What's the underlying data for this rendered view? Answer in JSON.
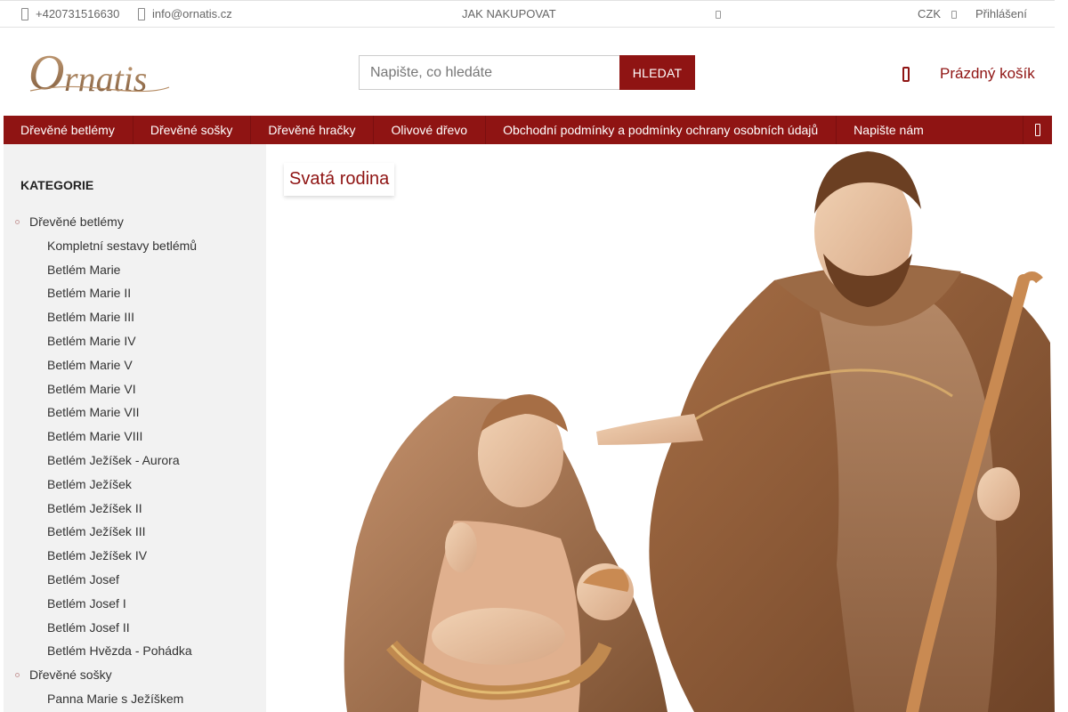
{
  "topbar": {
    "phone": "+420731516630",
    "email": "info@ornatis.cz",
    "how_to_buy": "JAK NAKUPOVAT",
    "currency": "CZK",
    "login": "Přihlášení",
    "icons": [
      "phone-icon",
      "mail-icon",
      "settings-icon",
      "chevron-icon"
    ]
  },
  "header": {
    "logo_text": "Ornatis",
    "search_placeholder": "Napište, co hledáte",
    "search_button": "HLEDAT",
    "cart_label": "Prázdný košík"
  },
  "nav": {
    "items": [
      "Dřevěné betlémy",
      "Dřevěné sošky",
      "Dřevěné hračky",
      "Olivové dřevo",
      "Obchodní podmínky a podmínky ochrany osobních údajů",
      "Napište nám"
    ]
  },
  "sidebar": {
    "title": "KATEGORIE",
    "cat1": "Dřevěné betlémy",
    "cat1_subs": [
      "Kompletní sestavy betlémů",
      "Betlém Marie",
      "Betlém Marie II",
      "Betlém Marie III",
      "Betlém Marie IV",
      "Betlém Marie V",
      "Betlém Marie VI",
      "Betlém Marie VII",
      "Betlém Marie VIII",
      "Betlém Ježíšek - Aurora",
      "Betlém Ježíšek",
      "Betlém Ježíšek II",
      "Betlém Ježíšek III",
      "Betlém Ježíšek IV",
      "Betlém Josef",
      "Betlém Josef I",
      "Betlém Josef II",
      "Betlém Hvězda - Pohádka"
    ],
    "cat2": "Dřevěné sošky",
    "cat2_subs": [
      "Panna Marie s Ježíškem"
    ]
  },
  "main": {
    "product_title": "Svatá rodina"
  },
  "colors": {
    "brand": "#8f1413",
    "sidebar_bg": "#f2f2f2"
  }
}
